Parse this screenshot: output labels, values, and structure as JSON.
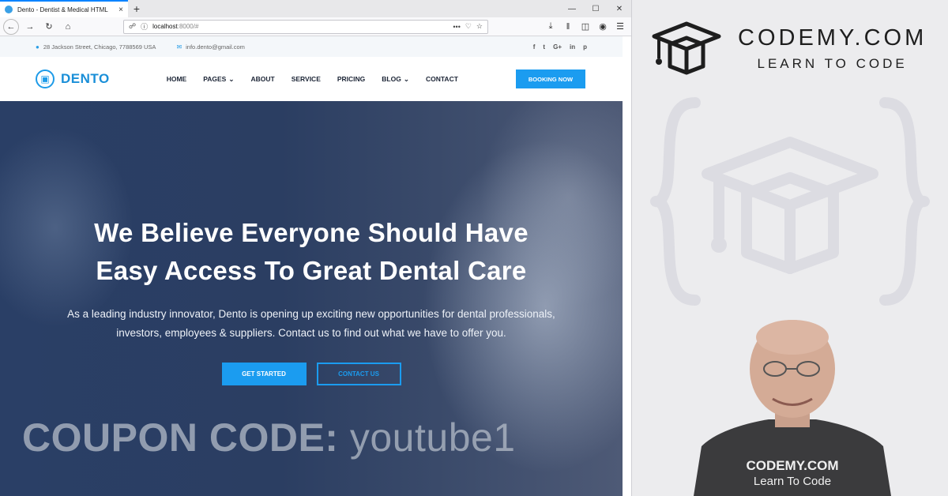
{
  "browser": {
    "tab_title": "Dento - Dentist & Medical HTML",
    "tab_close": "×",
    "new_tab": "+",
    "window_controls": [
      "—",
      "☐",
      "✕"
    ],
    "url_host": "localhost",
    "url_rest": ":8000/#",
    "url_more": "•••"
  },
  "site": {
    "address": "28 Jackson Street, Chicago, 7788569 USA",
    "email": "info.dento@gmail.com",
    "socials": [
      "f",
      "t",
      "G+",
      "in",
      "p"
    ],
    "logo_text": "DENTO",
    "menu": [
      {
        "label": "HOME"
      },
      {
        "label": "PAGES",
        "dropdown": true
      },
      {
        "label": "ABOUT"
      },
      {
        "label": "SERVICE"
      },
      {
        "label": "PRICING"
      },
      {
        "label": "BLOG",
        "dropdown": true
      },
      {
        "label": "CONTACT"
      }
    ],
    "booking_label": "BOOKING NOW",
    "hero_title_line1": "We Believe Everyone Should Have",
    "hero_title_line2": "Easy Access To Great Dental Care",
    "hero_text_line1": "As a leading industry innovator, Dento is opening up exciting new opportunities for dental professionals,",
    "hero_text_line2": "investors, employees & suppliers. Contact us to find out what we have to offer you.",
    "get_started_label": "GET STARTED",
    "contact_us_label": "CONTACT US"
  },
  "overlay": {
    "coupon_label": "COUPON CODE:",
    "coupon_code": "youtube1"
  },
  "panel": {
    "brand_name": "CODEMY.COM",
    "brand_tagline": "LEARN TO CODE",
    "shirt_line1": "CODEMY.COM",
    "shirt_line2": "Learn To Code"
  },
  "colors": {
    "accent": "#1b9cf0",
    "hero_dark": "#2a3f66",
    "panel_bg": "#ececee"
  }
}
